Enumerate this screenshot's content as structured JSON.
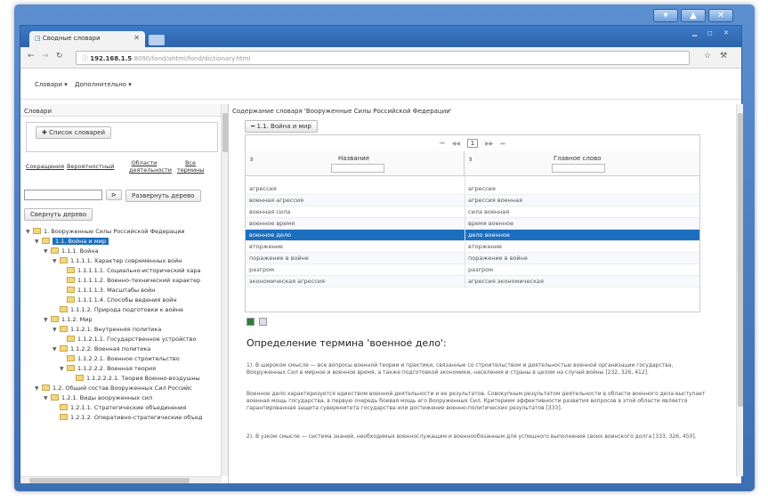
{
  "window": {
    "controls": [
      "▾",
      "▲",
      "✕"
    ]
  },
  "browser": {
    "tab_title": "Сводные словари",
    "url_host": "192.168.1.5",
    "url_rest": ":8090/fond/ahtml/fond/dictionary.html"
  },
  "menu": {
    "items": [
      "Словари ▾",
      "Дополнительно ▾"
    ]
  },
  "left": {
    "title": "Словари",
    "dict_list_button": "✚ Список словарей",
    "links": [
      "Сокращения",
      "Вероятностный",
      "Области деятельности",
      "Все термины"
    ],
    "search_button": "⊳",
    "expand_button": "Развернуть дерево",
    "collapse_button": "Свернуть дерево",
    "tree": [
      {
        "label": "1. Вооруженные Силы Российской Федерации",
        "level": 0,
        "expanded": true
      },
      {
        "label": "1.1. Война и мир",
        "level": 1,
        "expanded": true,
        "selected": true
      },
      {
        "label": "1.1.1. Война",
        "level": 2,
        "expanded": true
      },
      {
        "label": "1.1.1.1. Характер современных войн",
        "level": 3,
        "expanded": true
      },
      {
        "label": "1.1.1.1.1. Социально-исторический хара",
        "level": 4
      },
      {
        "label": "1.1.1.1.2. Военно-технический характер",
        "level": 4
      },
      {
        "label": "1.1.1.1.3. Масштабы войн",
        "level": 4
      },
      {
        "label": "1.1.1.1.4. Способы ведения войн",
        "level": 4
      },
      {
        "label": "1.1.1.2. Природа подготовки к войне",
        "level": 3
      },
      {
        "label": "1.1.2. Мир",
        "level": 2,
        "expanded": true
      },
      {
        "label": "1.1.2.1. Внутренняя политика",
        "level": 3,
        "expanded": true
      },
      {
        "label": "1.1.2.1.1. Государственное устройство",
        "level": 4
      },
      {
        "label": "1.1.2.2. Военная политика",
        "level": 3,
        "expanded": true
      },
      {
        "label": "1.1.2.2.1. Военное строительство",
        "level": 4
      },
      {
        "label": "1.1.2.2.2. Военная теория",
        "level": 4,
        "expanded": true
      },
      {
        "label": "1.1.2.2.2.1. Теория Военно-воздушны",
        "level": 5
      },
      {
        "label": "1.2. Общий состав Вооруженных Сил Российс",
        "level": 1,
        "expanded": true
      },
      {
        "label": "1.2.1. Виды вооруженных сил",
        "level": 2,
        "expanded": true
      },
      {
        "label": "1.2.1.1. Стратегические объединения",
        "level": 3
      },
      {
        "label": "1.2.1.2. Оперативно-стратегические объед",
        "level": 3
      }
    ]
  },
  "right": {
    "title": "Содержание словаря 'Вооруженные Силы Российской Федерации'",
    "section_button": "━ 1.1. Война и мир",
    "pager": {
      "first": "⏮",
      "prev": "◀◀",
      "page": "1",
      "next": "▶▶",
      "last": "⏭"
    },
    "columns": [
      "Название",
      "Главное слово"
    ],
    "rows": [
      [
        "агрессия",
        "агрессия"
      ],
      [
        "военная агрессия",
        "агрессия военная"
      ],
      [
        "военная сила",
        "сила военная"
      ],
      [
        "военное время",
        "время военное"
      ],
      [
        "военное дело",
        "дело военное"
      ],
      [
        "вторжение",
        "вторжение"
      ],
      [
        "поражение в войне",
        "поражение в войне"
      ],
      [
        "разгром",
        "разгром"
      ],
      [
        "экономическая агрессия",
        "агрессия экономическая"
      ]
    ],
    "active_row": 4,
    "definition_title": "Определение термина 'военное дело':",
    "paragraphs": [
      "1). В широком смысле — все вопросы военной теории и практики, связанные со строительством и деятельностью военной организации государства, Вооруженных Сил в мирное и военное время, а также подготовкой экономики, населения и страны в целом на случай войны [232, 326, 412].",
      "Военное дело характеризуется единством военной деятельности и ее результатов. Совокупным результатом деятельности в области военного дела выступает военная мощь государства, в первую очередь боевая мощь его Вооруженных Сил. Критерием эффективности развития вопросов в этой области является гарантированная защита суверенитета государства или достижение военно-политических результатов [333].",
      "2). В узком смысле — система знаний, необходимых военнослужащим и военнообязанным для успешного выполнения своих воинского долга [333, 326, 450]."
    ]
  }
}
